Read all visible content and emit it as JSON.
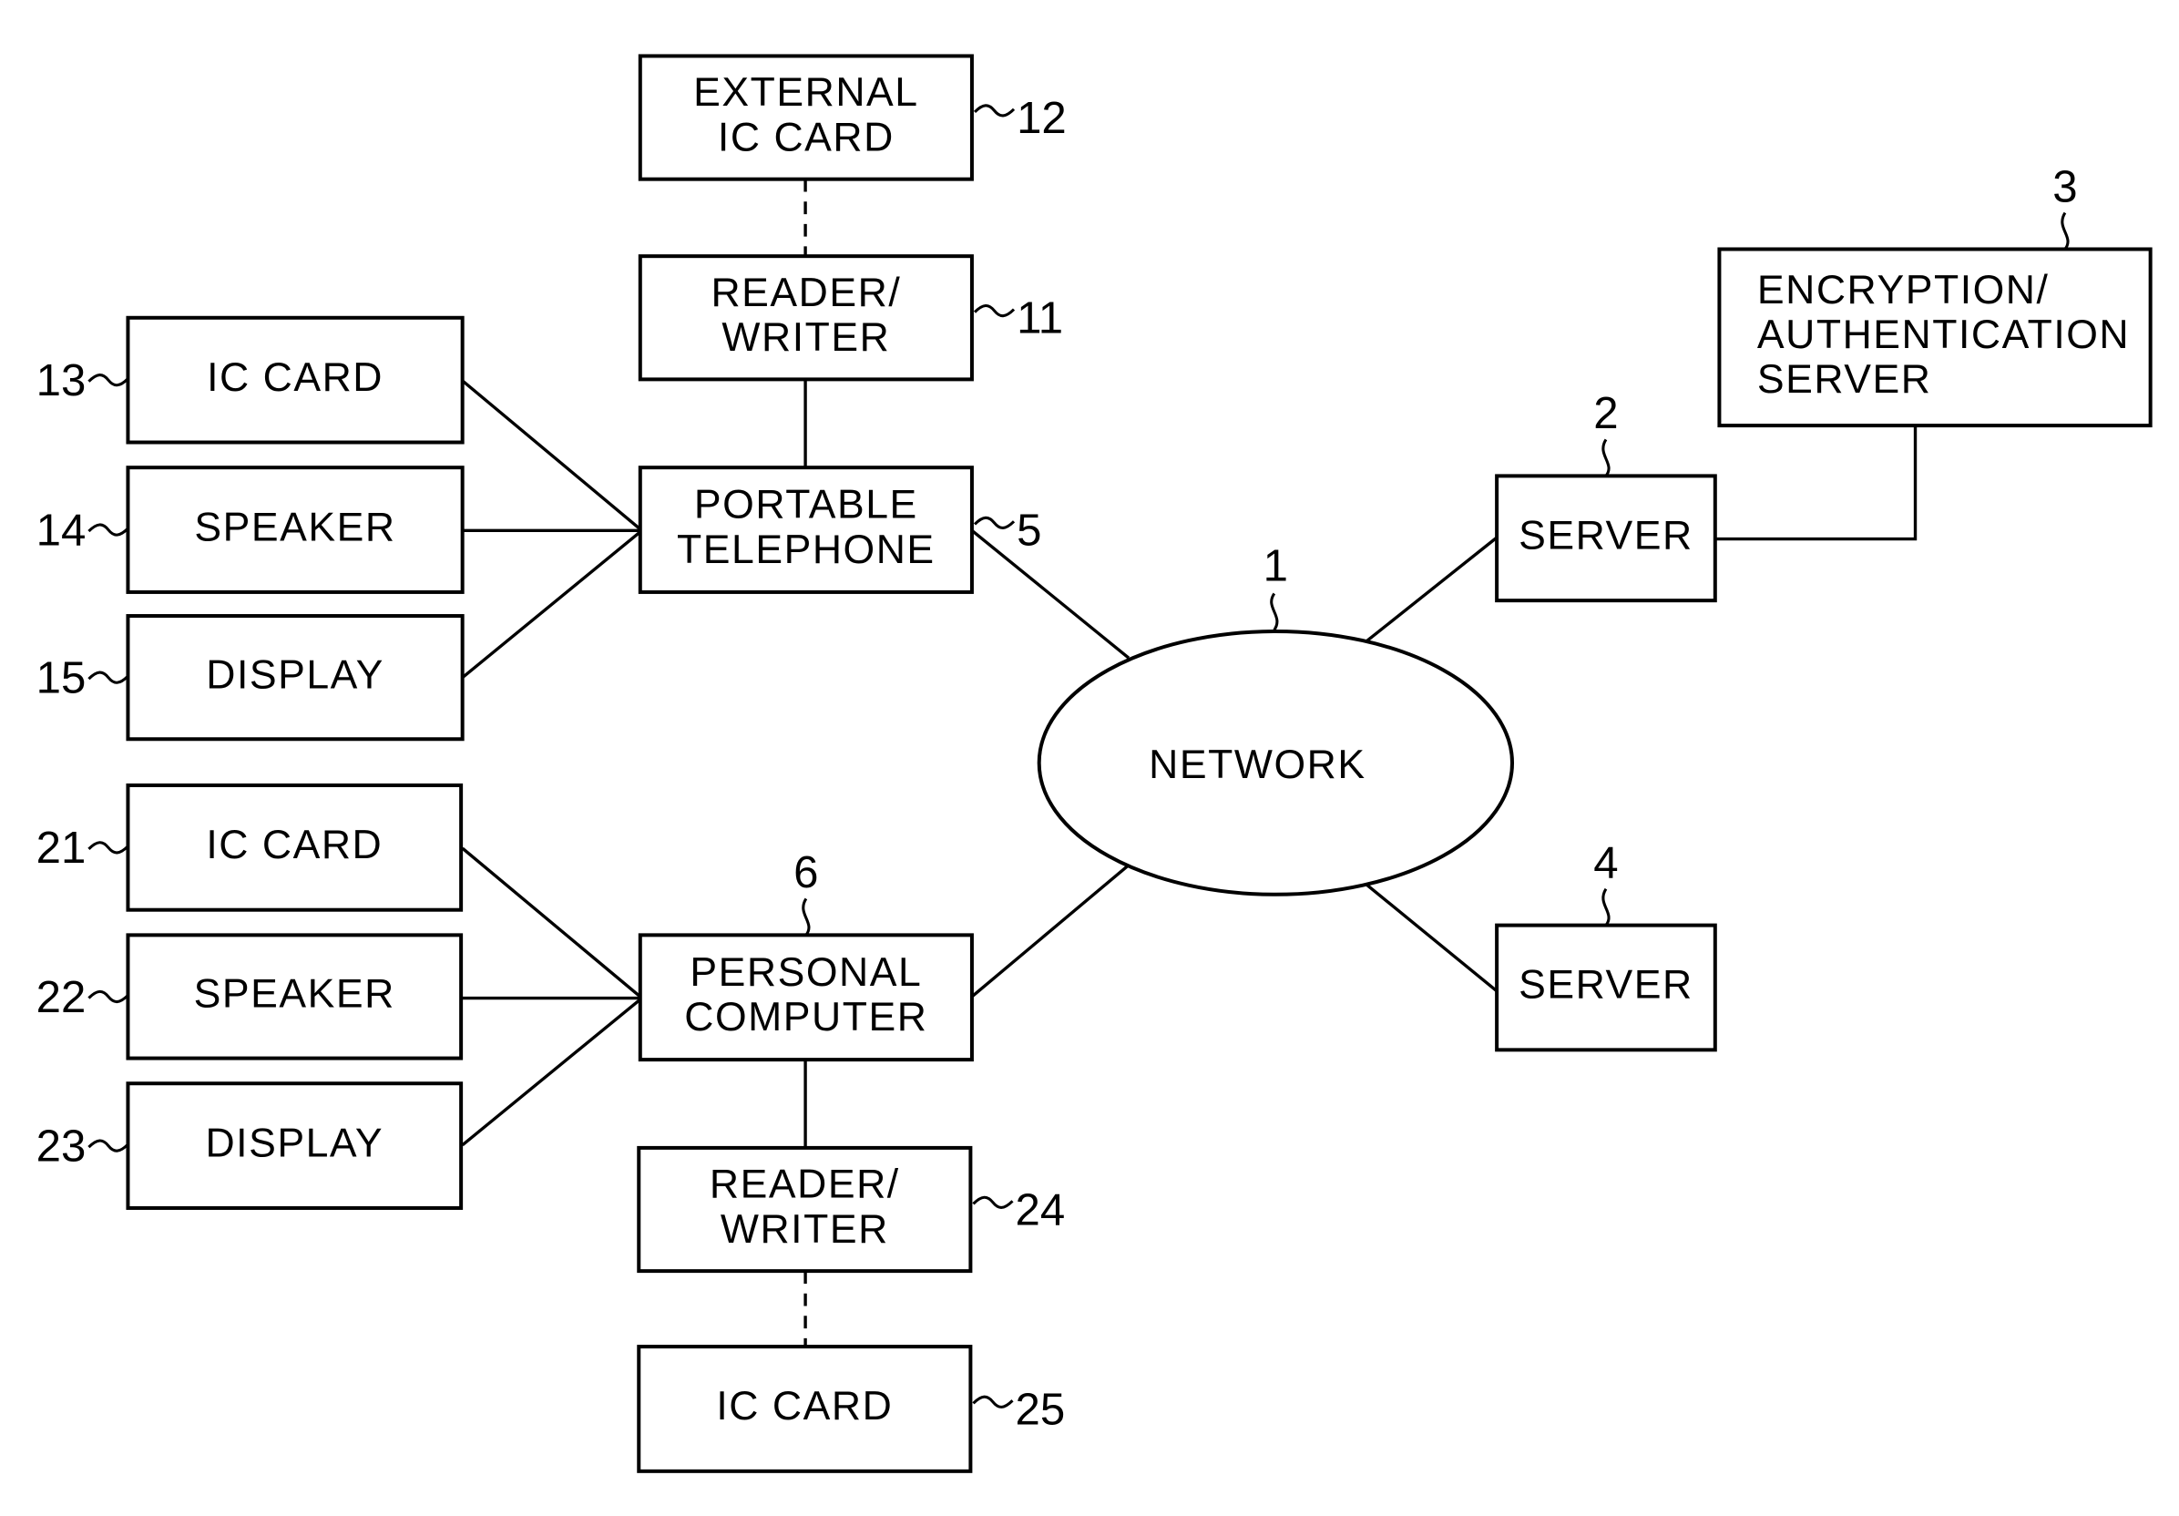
{
  "diagram": {
    "network": {
      "label": "NETWORK",
      "ref": "1"
    },
    "nodes": [
      {
        "id": "external-ic-card",
        "lines": [
          "EXTERNAL",
          "IC  CARD"
        ],
        "ref": "12"
      },
      {
        "id": "reader-writer-11",
        "lines": [
          "READER/",
          "WRITER"
        ],
        "ref": "11"
      },
      {
        "id": "portable-telephone",
        "lines": [
          "PORTABLE",
          "TELEPHONE"
        ],
        "ref": "5"
      },
      {
        "id": "ic-card-13",
        "lines": [
          "IC  CARD"
        ],
        "ref": "13"
      },
      {
        "id": "speaker-14",
        "lines": [
          "SPEAKER"
        ],
        "ref": "14"
      },
      {
        "id": "display-15",
        "lines": [
          "DISPLAY"
        ],
        "ref": "15"
      },
      {
        "id": "ic-card-21",
        "lines": [
          "IC  CARD"
        ],
        "ref": "21"
      },
      {
        "id": "speaker-22",
        "lines": [
          "SPEAKER"
        ],
        "ref": "22"
      },
      {
        "id": "display-23",
        "lines": [
          "DISPLAY"
        ],
        "ref": "23"
      },
      {
        "id": "personal-computer",
        "lines": [
          "PERSONAL",
          "COMPUTER"
        ],
        "ref": "6"
      },
      {
        "id": "reader-writer-24",
        "lines": [
          "READER/",
          "WRITER"
        ],
        "ref": "24"
      },
      {
        "id": "ic-card-25",
        "lines": [
          "IC  CARD"
        ],
        "ref": "25"
      },
      {
        "id": "server-2",
        "lines": [
          "SERVER"
        ],
        "ref": "2"
      },
      {
        "id": "server-4",
        "lines": [
          "SERVER"
        ],
        "ref": "4"
      },
      {
        "id": "encryption-authentication-server",
        "lines": [
          "ENCRYPTION/",
          "AUTHENTICATION",
          "SERVER"
        ],
        "ref": "3"
      }
    ],
    "connections": [
      {
        "from": "external-ic-card",
        "to": "reader-writer-11",
        "style": "dashed"
      },
      {
        "from": "reader-writer-11",
        "to": "portable-telephone",
        "style": "solid"
      },
      {
        "from": "ic-card-13",
        "to": "portable-telephone",
        "style": "solid"
      },
      {
        "from": "speaker-14",
        "to": "portable-telephone",
        "style": "solid"
      },
      {
        "from": "display-15",
        "to": "portable-telephone",
        "style": "solid"
      },
      {
        "from": "portable-telephone",
        "to": "network",
        "style": "solid"
      },
      {
        "from": "ic-card-21",
        "to": "personal-computer",
        "style": "solid"
      },
      {
        "from": "speaker-22",
        "to": "personal-computer",
        "style": "solid"
      },
      {
        "from": "display-23",
        "to": "personal-computer",
        "style": "solid"
      },
      {
        "from": "personal-computer",
        "to": "network",
        "style": "solid"
      },
      {
        "from": "personal-computer",
        "to": "reader-writer-24",
        "style": "solid"
      },
      {
        "from": "reader-writer-24",
        "to": "ic-card-25",
        "style": "dashed"
      },
      {
        "from": "network",
        "to": "server-2",
        "style": "solid"
      },
      {
        "from": "server-2",
        "to": "encryption-authentication-server",
        "style": "solid"
      },
      {
        "from": "network",
        "to": "server-4",
        "style": "solid"
      }
    ]
  }
}
